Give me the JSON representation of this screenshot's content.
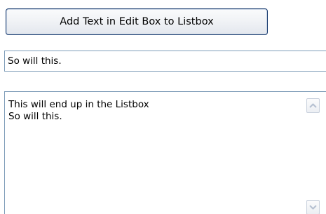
{
  "form": {
    "add_button_label": "Add Text in Edit Box to Listbox",
    "edit_box_value": "So will this."
  },
  "listbox": {
    "items": [
      "This will end up in the Listbox",
      "So will this."
    ],
    "scroll_up_icon": "chevron-up-icon",
    "scroll_down_icon": "chevron-down-icon"
  }
}
